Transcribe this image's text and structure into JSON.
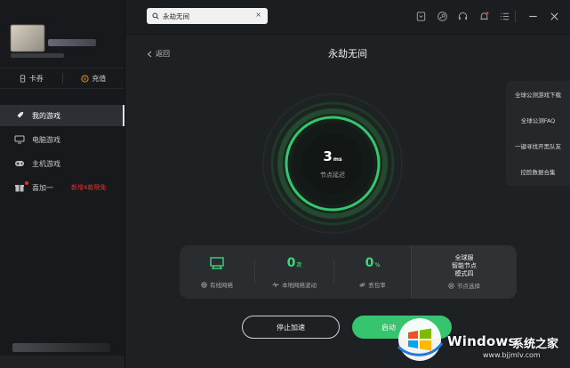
{
  "sidebar": {
    "quick": {
      "card_label": "卡券",
      "recharge_label": "充值"
    },
    "nav": [
      {
        "label": "我的游戏",
        "icon": "rocket-icon",
        "active": true
      },
      {
        "label": "电脑游戏",
        "icon": "monitor-icon",
        "active": false
      },
      {
        "label": "主机游戏",
        "icon": "gamepad-icon",
        "active": false
      },
      {
        "label": "喜加一",
        "icon": "gift-icon",
        "active": false,
        "promo": "新增4款限免"
      }
    ]
  },
  "topbar": {
    "search": {
      "value": "永劫无间"
    },
    "icons": [
      "badge-icon",
      "steam-icon",
      "headset-icon",
      "bell-icon",
      "menu-icon",
      "minimize-icon",
      "close-icon"
    ]
  },
  "main": {
    "back_label": "返回",
    "title": "永劫无间",
    "latency": {
      "value": "3",
      "unit": "ms",
      "label": "节点延迟"
    },
    "side_panel": [
      "全球公测游戏下载",
      "全球公测FAQ",
      "一键寻找开黑队友",
      "控脸数据合集"
    ],
    "stats": {
      "network": {
        "label": "有线网络"
      },
      "fluctuation": {
        "value": "0",
        "unit": "次",
        "label": "本地网络波动"
      },
      "packet_loss": {
        "value": "0",
        "unit": "%",
        "label": "丢包率"
      },
      "node": {
        "line1": "全球服",
        "line2": "智能节点",
        "line3": "模式四",
        "label": "节点选择"
      }
    },
    "buttons": {
      "stop": "停止加速",
      "start": "启动"
    }
  },
  "watermark": {
    "brand": "Windows",
    "cn": "系统之家",
    "url": "www.bjjmlv.com"
  },
  "colors": {
    "accent": "#36c46e",
    "promo": "#e0332f",
    "bg": "#1e2124",
    "sidebar": "#17191c"
  }
}
